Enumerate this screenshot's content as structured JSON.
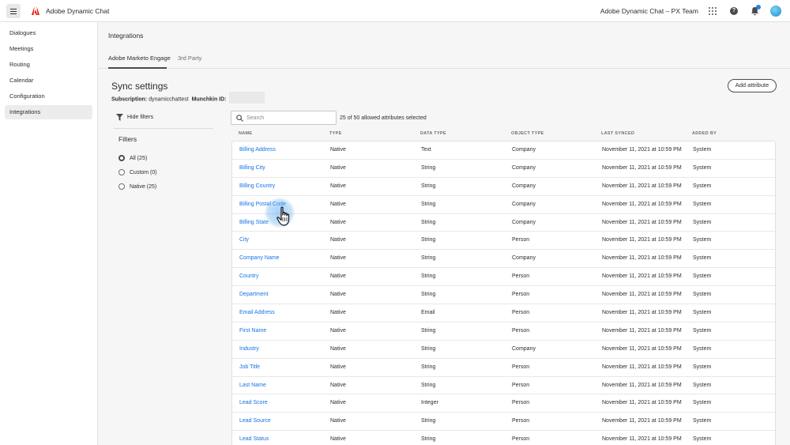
{
  "topbar": {
    "app_name": "Adobe Dynamic Chat",
    "workspace": "Adobe Dynamic Chat – PX Team",
    "icons": [
      "menu-icon",
      "adobe-logo-icon",
      "apps-grid-icon",
      "help-icon",
      "notifications-bell-icon",
      "user-avatar"
    ],
    "help_glyph": "?"
  },
  "sidebar": {
    "items": [
      {
        "label": "Dialogues",
        "active": false
      },
      {
        "label": "Meetings",
        "active": false
      },
      {
        "label": "Routing",
        "active": false
      },
      {
        "label": "Calendar",
        "active": false
      },
      {
        "label": "Configuration",
        "active": false
      },
      {
        "label": "Integrations",
        "active": true
      }
    ]
  },
  "main": {
    "title": "Integrations",
    "tabs": [
      {
        "label": "Adobe Marketo Engage",
        "selected": true
      },
      {
        "label": "3rd Party",
        "selected": false
      }
    ]
  },
  "sync": {
    "title": "Sync settings",
    "subscription_label": "Subscription:",
    "subscription_value": "dynamicchattest",
    "munchkin_label": "Munchkin ID:",
    "add_button": "Add attribute"
  },
  "filters": {
    "toggle_label": "Hide filters",
    "heading": "Filters",
    "options": [
      {
        "label": "All (25)",
        "checked": true
      },
      {
        "label": "Custom (0)",
        "checked": false
      },
      {
        "label": "Native (25)",
        "checked": false
      }
    ]
  },
  "search": {
    "placeholder": "Search",
    "value": ""
  },
  "count_text": "25 of 50 allowed attributes selected",
  "table": {
    "columns": [
      "NAME",
      "TYPE",
      "DATA TYPE",
      "OBJECT TYPE",
      "LAST SYNCED",
      "ADDED BY"
    ],
    "rows": [
      [
        "Billing Address",
        "Native",
        "Text",
        "Company",
        "November 11, 2021 at 10:59 PM",
        "System"
      ],
      [
        "Billing City",
        "Native",
        "String",
        "Company",
        "November 11, 2021 at 10:59 PM",
        "System"
      ],
      [
        "Billing Country",
        "Native",
        "String",
        "Company",
        "November 11, 2021 at 10:59 PM",
        "System"
      ],
      [
        "Billing Postal Code",
        "Native",
        "String",
        "Company",
        "November 11, 2021 at 10:59 PM",
        "System"
      ],
      [
        "Billing State",
        "Native",
        "String",
        "Company",
        "November 11, 2021 at 10:59 PM",
        "System"
      ],
      [
        "City",
        "Native",
        "String",
        "Person",
        "November 11, 2021 at 10:59 PM",
        "System"
      ],
      [
        "Company Name",
        "Native",
        "String",
        "Company",
        "November 11, 2021 at 10:59 PM",
        "System"
      ],
      [
        "Country",
        "Native",
        "String",
        "Person",
        "November 11, 2021 at 10:59 PM",
        "System"
      ],
      [
        "Department",
        "Native",
        "String",
        "Person",
        "November 11, 2021 at 10:59 PM",
        "System"
      ],
      [
        "Email Address",
        "Native",
        "Email",
        "Person",
        "November 11, 2021 at 10:59 PM",
        "System"
      ],
      [
        "First Name",
        "Native",
        "String",
        "Person",
        "November 11, 2021 at 10:59 PM",
        "System"
      ],
      [
        "Industry",
        "Native",
        "String",
        "Company",
        "November 11, 2021 at 10:59 PM",
        "System"
      ],
      [
        "Job Title",
        "Native",
        "String",
        "Person",
        "November 11, 2021 at 10:59 PM",
        "System"
      ],
      [
        "Last Name",
        "Native",
        "String",
        "Person",
        "November 11, 2021 at 10:59 PM",
        "System"
      ],
      [
        "Lead Score",
        "Native",
        "Integer",
        "Person",
        "November 11, 2021 at 10:59 PM",
        "System"
      ],
      [
        "Lead Source",
        "Native",
        "String",
        "Person",
        "November 11, 2021 at 10:59 PM",
        "System"
      ],
      [
        "Lead Status",
        "Native",
        "String",
        "Person",
        "November 11, 2021 at 10:59 PM",
        "System"
      ]
    ]
  },
  "colors": {
    "link": "#1473e6",
    "adobe_red": "#eb1000",
    "accent_blue": "#2680eb"
  }
}
